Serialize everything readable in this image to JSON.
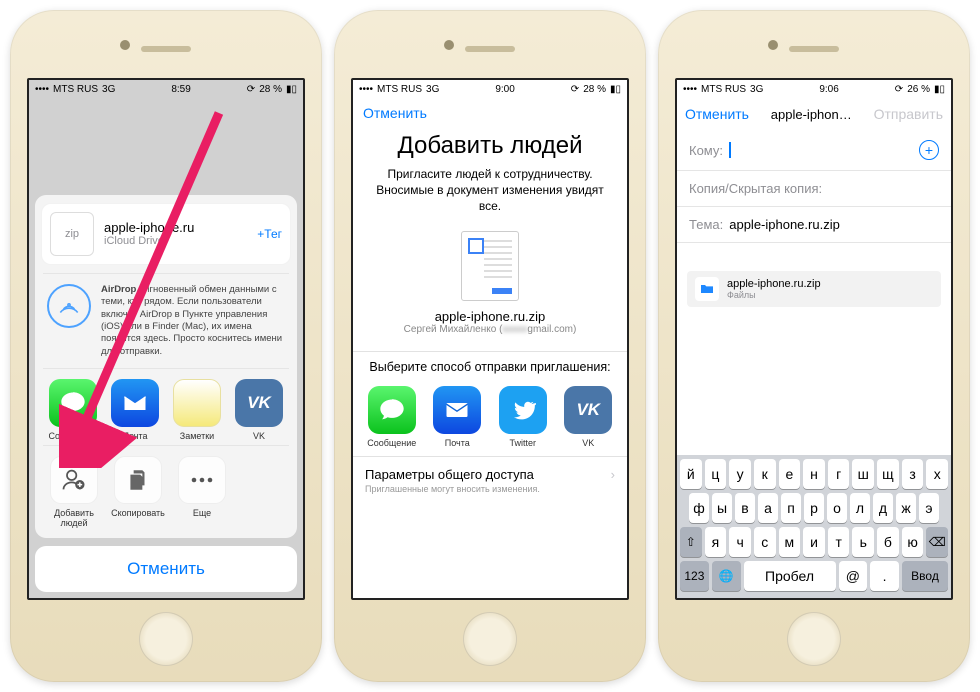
{
  "phones": [
    {
      "status": {
        "carrier": "MTS RUS",
        "net": "3G",
        "time": "8:59",
        "battery": "28 %"
      },
      "file": {
        "ext": "zip",
        "name": "apple-iphone.ru",
        "location": "iCloud Drive",
        "tag": "+Тег"
      },
      "airdrop": {
        "title": "AirDrop.",
        "desc": "Мгновенный обмен данными с теми, кто рядом. Если пользователи включат AirDrop в Пункте управления (iOS) или в Finder (Mac), их имена появятся здесь. Просто коснитесь имени для отправки."
      },
      "apps": [
        {
          "label": "Сообщение",
          "cls": "ic-msg"
        },
        {
          "label": "Почта",
          "cls": "ic-mail"
        },
        {
          "label": "Заметки",
          "cls": "ic-notes"
        },
        {
          "label": "VK",
          "cls": "ic-vk"
        }
      ],
      "actions": [
        {
          "label": "Добавить людей"
        },
        {
          "label": "Скопировать"
        },
        {
          "label": "Еще"
        }
      ],
      "cancel": "Отменить"
    },
    {
      "status": {
        "carrier": "MTS RUS",
        "net": "3G",
        "time": "9:00",
        "battery": "28 %"
      },
      "cancel": "Отменить",
      "title": "Добавить людей",
      "subtitle": "Пригласите людей к сотрудничеству. Вносимые в документ изменения увидят все.",
      "doc": {
        "name": "apple-iphone.ru.zip",
        "owner_name": "Сергей Михайленко",
        "owner_mail": "gmail.com)"
      },
      "invite_header": "Выберите способ отправки приглашения:",
      "apps": [
        {
          "label": "Сообщение",
          "cls": "ic-msg"
        },
        {
          "label": "Почта",
          "cls": "ic-mail"
        },
        {
          "label": "Twitter",
          "cls": "ic-tw"
        },
        {
          "label": "VK",
          "cls": "ic-vk"
        }
      ],
      "settings": {
        "title": "Параметры общего доступа",
        "sub": "Приглашенные могут вносить изменения."
      }
    },
    {
      "status": {
        "carrier": "MTS RUS",
        "net": "3G",
        "time": "9:06",
        "battery": "26 %"
      },
      "nav": {
        "cancel": "Отменить",
        "title": "apple-iphon…",
        "send": "Отправить"
      },
      "fields": {
        "to_label": "Кому:",
        "cc_label": "Копия/Скрытая копия:",
        "subj_label": "Тема:",
        "subj_value": "apple-iphone.ru.zip"
      },
      "attachment": {
        "name": "apple-iphone.ru.zip",
        "source": "Файлы"
      },
      "keyboard": {
        "row1": [
          "й",
          "ц",
          "у",
          "к",
          "е",
          "н",
          "г",
          "ш",
          "щ",
          "з",
          "х"
        ],
        "row2": [
          "ф",
          "ы",
          "в",
          "а",
          "п",
          "р",
          "о",
          "л",
          "д",
          "ж",
          "э"
        ],
        "row3": [
          "я",
          "ч",
          "с",
          "м",
          "и",
          "т",
          "ь",
          "б",
          "ю"
        ],
        "shift": "⇧",
        "bksp": "⌫",
        "num": "123",
        "globe": "🌐",
        "space": "Пробел",
        "at": "@",
        "dot": ".",
        "enter": "Ввод"
      }
    }
  ]
}
